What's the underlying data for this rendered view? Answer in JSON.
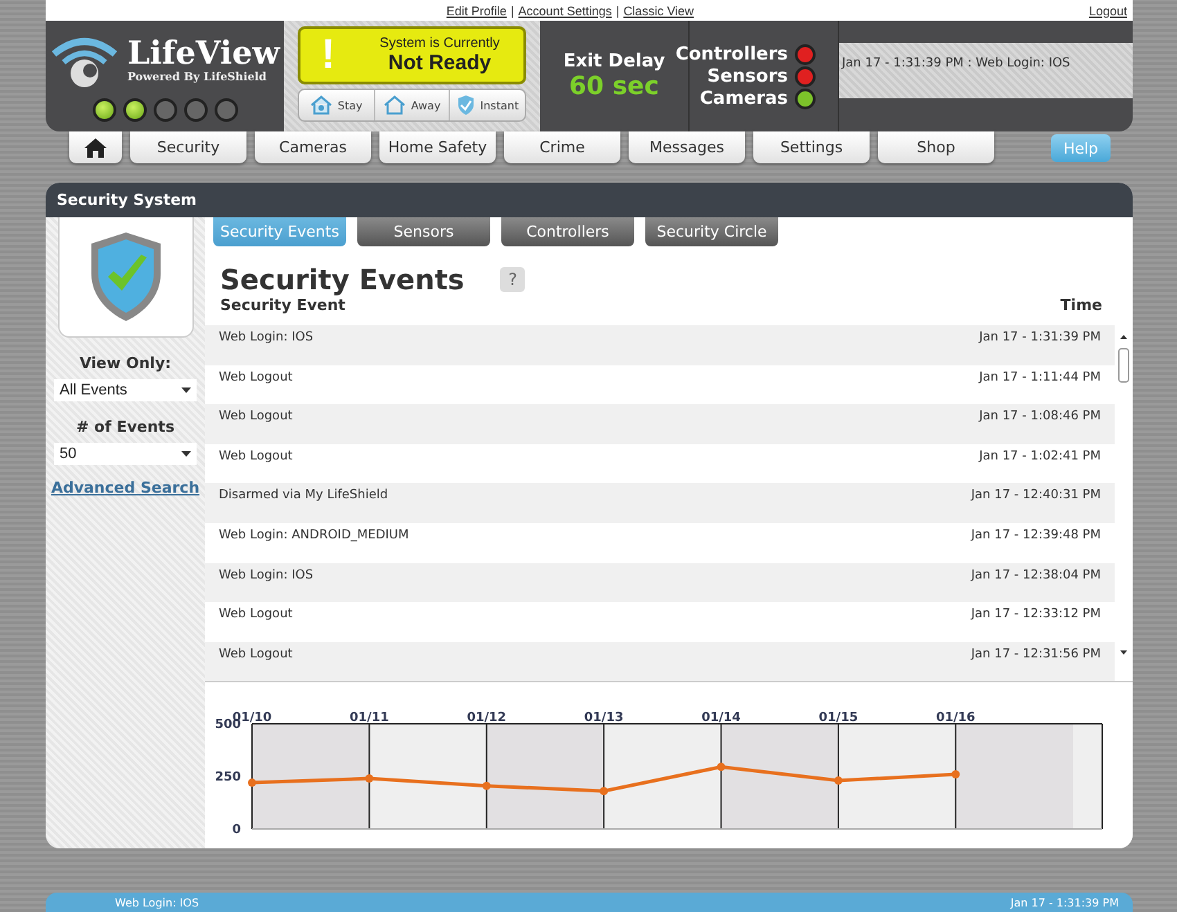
{
  "top_links": [
    "Edit Profile",
    "Account Settings",
    "Classic View"
  ],
  "link_separator": "|",
  "logout": "Logout",
  "logo": {
    "name": "LifeView",
    "tagline": "Powered By LifeShield"
  },
  "status_dots": [
    {
      "on": true
    },
    {
      "on": true
    },
    {
      "on": false
    },
    {
      "on": false
    },
    {
      "on": false
    }
  ],
  "system_status": {
    "icon_text": "!",
    "line1": "System is Currently",
    "line2": "Not Ready"
  },
  "arm_modes": [
    {
      "label": "Stay",
      "kind": "house"
    },
    {
      "label": "Away",
      "kind": "roof"
    },
    {
      "label": "Instant",
      "kind": "shield"
    }
  ],
  "exit_delay": {
    "label": "Exit Delay",
    "value": "60 sec"
  },
  "indicators": [
    {
      "label": "Controllers",
      "color": "#e02020"
    },
    {
      "label": "Sensors",
      "color": "#e02020"
    },
    {
      "label": "Cameras",
      "color": "#7cc22a"
    }
  ],
  "ticker": [
    "Jan 17 - 1:31:39 PM : Web Login: IOS"
  ],
  "nav": [
    "Security",
    "Cameras",
    "Home Safety",
    "Crime",
    "Messages",
    "Settings",
    "Shop"
  ],
  "help": "Help",
  "panel_title": "Security System",
  "sidebar": {
    "view_only_label": "View Only:",
    "view_only_value": "All Events",
    "events_label": "# of Events",
    "events_value": "50",
    "advanced_search": "Advanced Search"
  },
  "tabs": [
    {
      "label": "Security Events",
      "selected": true
    },
    {
      "label": "Sensors",
      "selected": false
    },
    {
      "label": "Controllers",
      "selected": false
    },
    {
      "label": "Security Circle",
      "selected": false
    }
  ],
  "heading": "Security Events",
  "help_badge": "?",
  "table": {
    "columns": [
      "Security Event",
      "Time"
    ],
    "rows": [
      [
        "Web Login: IOS",
        "Jan 17 - 1:31:39 PM"
      ],
      [
        "Web Logout",
        "Jan 17 - 1:11:44 PM"
      ],
      [
        "Web Logout",
        "Jan 17 - 1:08:46 PM"
      ],
      [
        "Web Logout",
        "Jan 17 - 1:02:41 PM"
      ],
      [
        "Disarmed via My LifeShield",
        "Jan 17 - 12:40:31 PM"
      ],
      [
        "Web Login: ANDROID_MEDIUM",
        "Jan 17 - 12:39:48 PM"
      ],
      [
        "Web Login: IOS",
        "Jan 17 - 12:38:04 PM"
      ],
      [
        "Web Logout",
        "Jan 17 - 12:33:12 PM"
      ],
      [
        "Web Logout",
        "Jan 17 - 12:31:56 PM"
      ]
    ]
  },
  "chart_data": {
    "type": "line",
    "categories": [
      "01/10",
      "01/11",
      "01/12",
      "01/13",
      "01/14",
      "01/15",
      "01/16"
    ],
    "series": [
      {
        "color": "#e8701e",
        "marker": "o",
        "values": [
          220,
          240,
          205,
          180,
          295,
          230,
          260
        ]
      }
    ],
    "grid": true,
    "ylim": [
      0,
      500
    ],
    "yticks": [
      0,
      250,
      500
    ]
  },
  "bottom_bar": {
    "text": "Web Login: IOS",
    "time": "Jan 17 - 1:31:39 PM"
  }
}
